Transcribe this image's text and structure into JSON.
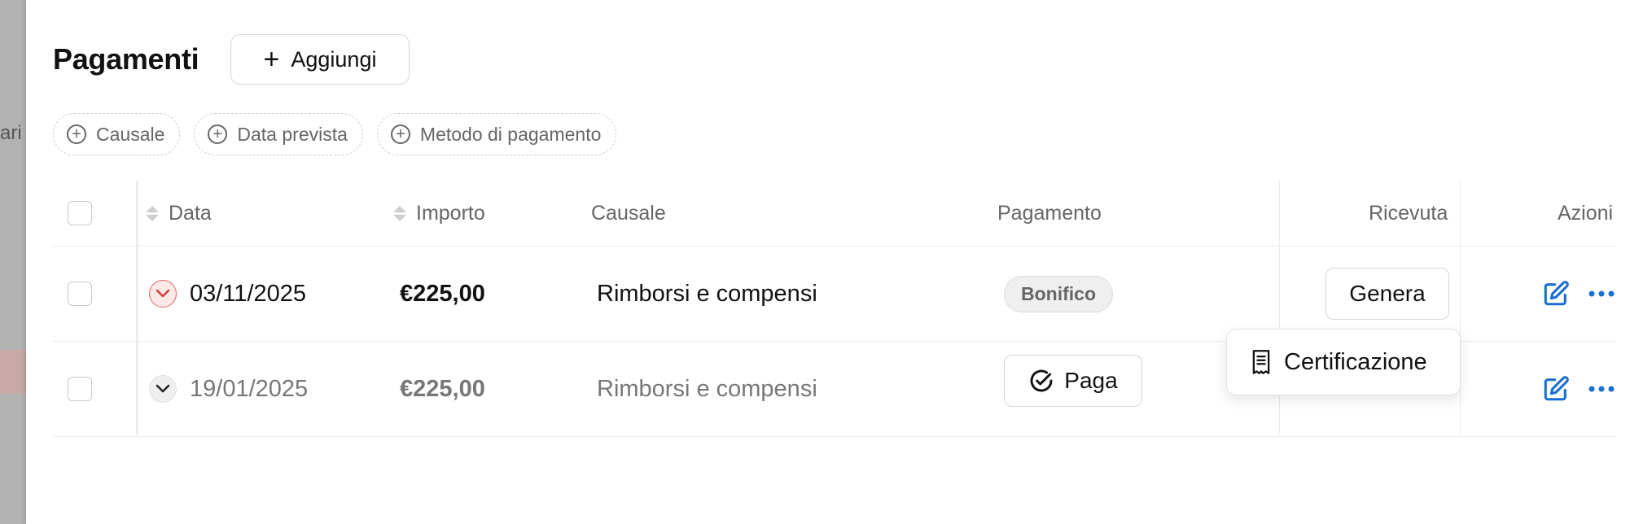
{
  "backdrop": {
    "partial_text": "ari"
  },
  "header": {
    "title": "Pagamenti",
    "add_label": "Aggiungi"
  },
  "filters": [
    {
      "label": "Causale"
    },
    {
      "label": "Data prevista"
    },
    {
      "label": "Metodo di pagamento"
    }
  ],
  "table": {
    "columns": {
      "data": "Data",
      "importo": "Importo",
      "causale": "Causale",
      "pagamento": "Pagamento",
      "ricevuta": "Ricevuta",
      "azioni": "Azioni"
    },
    "rows": [
      {
        "date": "03/11/2025",
        "amount": "€225,00",
        "causale": "Rimborsi e compensi",
        "payment_badge": "Bonifico",
        "receipt_button": "Genera",
        "expand_state": "red"
      },
      {
        "date": "19/01/2025",
        "amount": "€225,00",
        "causale": "Rimborsi e compensi",
        "pay_button": "Paga",
        "expand_state": "grey"
      }
    ]
  },
  "popover": {
    "item_label": "Certificazione"
  },
  "colors": {
    "accent": "#1a6fd1",
    "danger": "#d33a3a"
  }
}
